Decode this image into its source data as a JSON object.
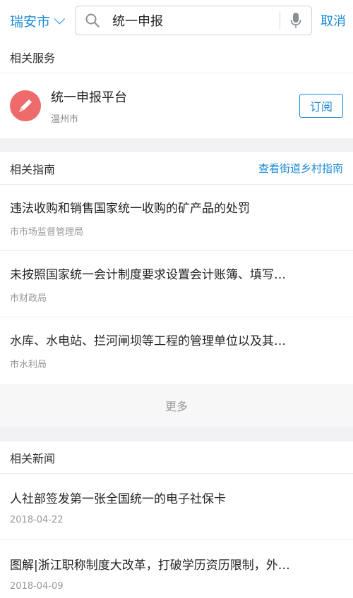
{
  "header": {
    "city": "瑞安市",
    "search_value": "统一申报",
    "cancel": "取消"
  },
  "services": {
    "title": "相关服务",
    "item": {
      "name": "统一申报平台",
      "region": "温州市",
      "subscribe": "订阅"
    }
  },
  "guides": {
    "title": "相关指南",
    "link": "查看街道乡村指南",
    "items": [
      {
        "title": "违法收购和销售国家统一收购的矿产品的处罚",
        "source": "市市场监督管理局"
      },
      {
        "title": "未按照国家统一会计制度要求设置会计账簿、填写…",
        "source": "市财政局"
      },
      {
        "title": "水库、水电站、拦河闸坝等工程的管理单位以及其…",
        "source": "市水利局"
      }
    ],
    "more": "更多"
  },
  "news": {
    "title": "相关新闻",
    "items": [
      {
        "title": "人社部签发第一张全国统一的电子社保卡",
        "date": "2018-04-22"
      },
      {
        "title": "图解|浙江职称制度大改革，打破学历资历限制，外…",
        "date": "2018-04-09"
      }
    ]
  },
  "colors": {
    "accent": "#1a8ad6",
    "logo": "#ef6a6a"
  }
}
